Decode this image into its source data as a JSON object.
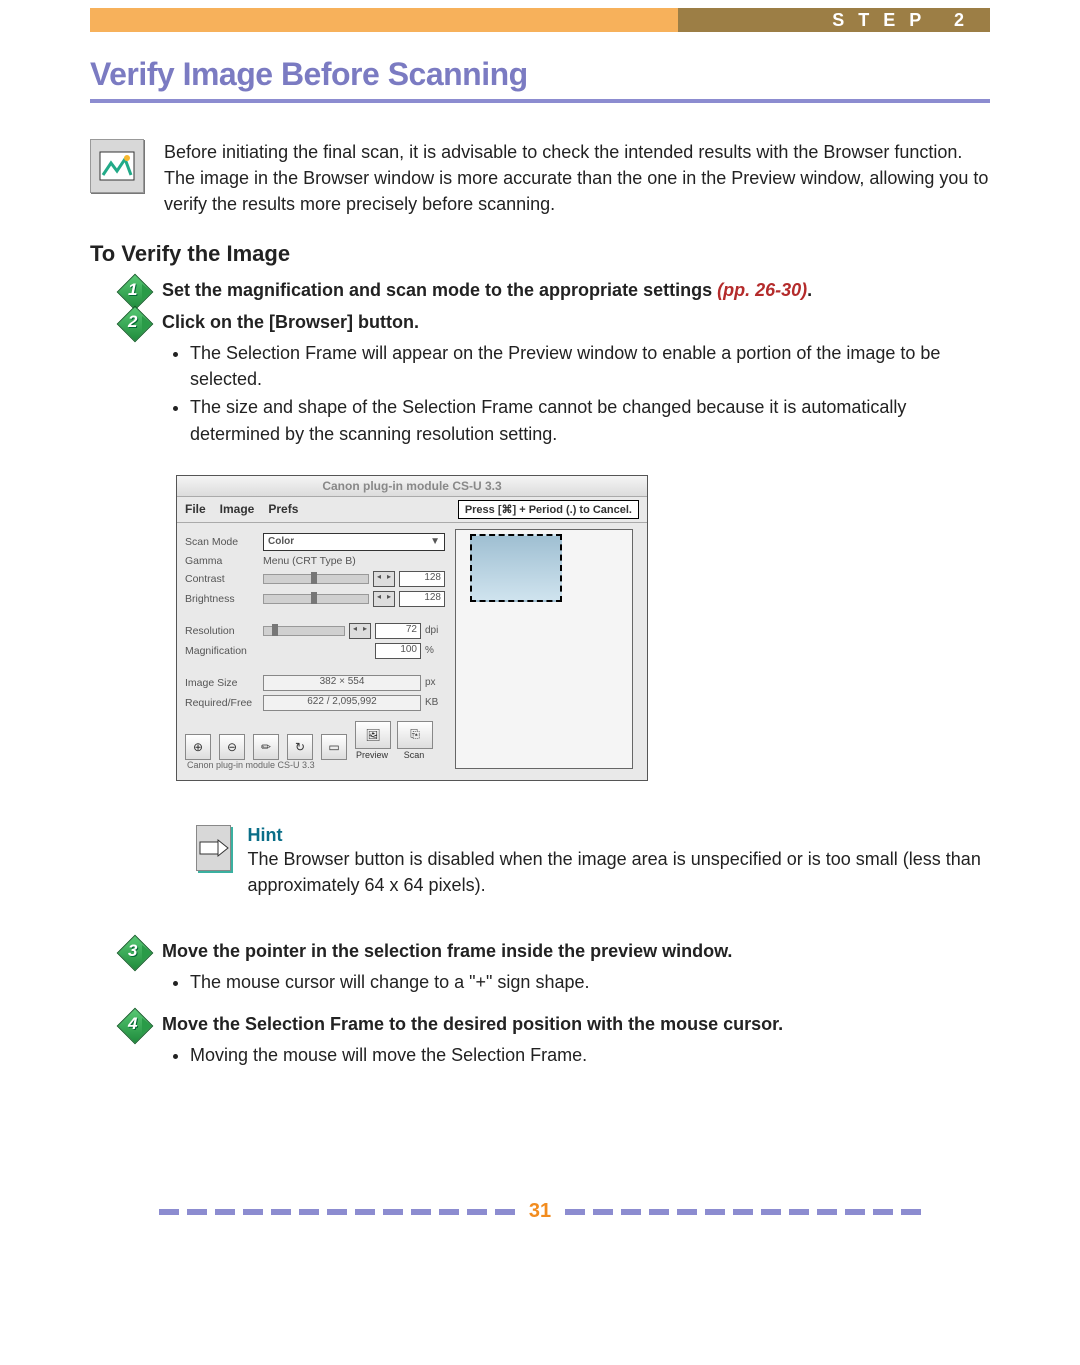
{
  "header": {
    "step_label": "STEP 2"
  },
  "title": "Verify Image Before Scanning",
  "intro": "Before initiating the final scan, it is advisable to check the intended results with the Browser function. The image in the Browser window is more accurate than the one in the Preview window, allowing you to verify the results more precisely before scanning.",
  "section_title": "To Verify the Image",
  "steps": {
    "s1": {
      "num": "1",
      "heading_prefix": "Set the magnification and scan mode to the appropriate settings ",
      "page_ref": "(pp. 26-30)",
      "heading_suffix": "."
    },
    "s2": {
      "num": "2",
      "heading": "Click on the [Browser] button.",
      "bullets": [
        "The Selection Frame will appear on the Preview window to enable a portion of the image to be selected.",
        "The size and shape of the Selection Frame cannot be changed because it is automatically determined by the scanning resolution setting."
      ]
    },
    "s3": {
      "num": "3",
      "heading": "Move the pointer in the selection frame inside the preview window.",
      "bullets": [
        "The mouse cursor will change to a \"+\" sign shape."
      ]
    },
    "s4": {
      "num": "4",
      "heading": "Move the Selection Frame to the desired position with the mouse cursor.",
      "bullets": [
        "Moving the mouse will move the Selection Frame."
      ]
    }
  },
  "scanner": {
    "title": "Canon plug-in module CS-U 3.3",
    "menu": {
      "file": "File",
      "image": "Image",
      "prefs": "Prefs"
    },
    "cancel_hint": "Press [⌘] + Period (.) to Cancel.",
    "labels": {
      "scan_mode": "Scan Mode",
      "gamma": "Gamma",
      "contrast": "Contrast",
      "brightness": "Brightness",
      "resolution": "Resolution",
      "magnification": "Magnification",
      "image_size": "Image Size",
      "required_free": "Required/Free"
    },
    "values": {
      "scan_mode": "Color",
      "gamma": "Menu (CRT Type B)",
      "contrast": "128",
      "brightness": "128",
      "resolution": "72",
      "resolution_unit": "dpi",
      "magnification": "100",
      "magnification_unit": "%",
      "image_size": "382 × 554",
      "image_size_unit": "px",
      "required_free": "622 / 2,095,992",
      "required_free_unit": "KB"
    },
    "tools": {
      "zoom_in": "⊕",
      "zoom_out": "⊖",
      "crop": "✏",
      "rotate": "↻",
      "browser": "▭",
      "preview_label": "Preview",
      "scan": "⎘",
      "scan_label": "Scan"
    },
    "footer": "Canon plug-in module CS-U 3.3"
  },
  "hint": {
    "title": "Hint",
    "body": "The Browser button is disabled when the image area is unspecified or is too small (less than approximately 64 x 64 pixels)."
  },
  "page_number": "31"
}
